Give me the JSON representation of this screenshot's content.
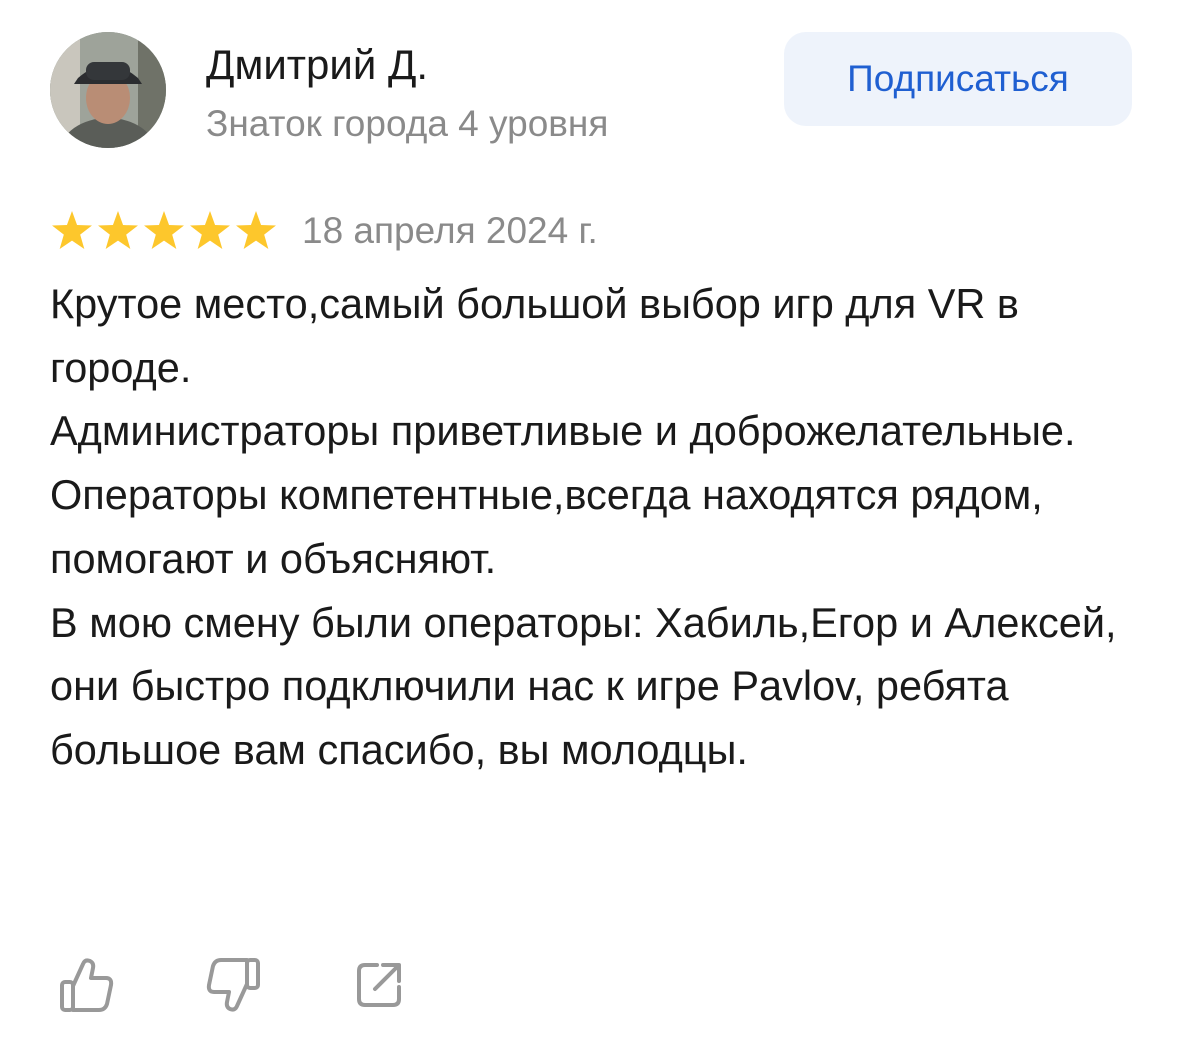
{
  "author": {
    "name": "Дмитрий Д.",
    "level": "Знаток города 4 уровня",
    "subscribe_label": "Подписаться"
  },
  "rating": {
    "stars": 5,
    "max_stars": 5,
    "date": "18 апреля 2024 г."
  },
  "review": {
    "paragraphs": [
      "Крутое место,самый большой выбор игр для VR в городе.",
      "Администраторы приветливые и доброжелательные.",
      "Операторы компетентные,всегда находятся рядом, помогают и объясняют.",
      "В мою смену были операторы: Хабиль,Егор и Алексей, они быстро подключили нас к игре Pavlov, ребята большое вам спасибо, вы молодцы."
    ]
  },
  "actions": {
    "like_icon": "thumbs-up-icon",
    "dislike_icon": "thumbs-down-icon",
    "share_icon": "share-icon"
  },
  "colors": {
    "star": "#fdc72c",
    "accent": "#1f5fd1",
    "button_bg": "#eef3fb",
    "secondary_text": "#8a8a8a",
    "icon": "#999999"
  }
}
